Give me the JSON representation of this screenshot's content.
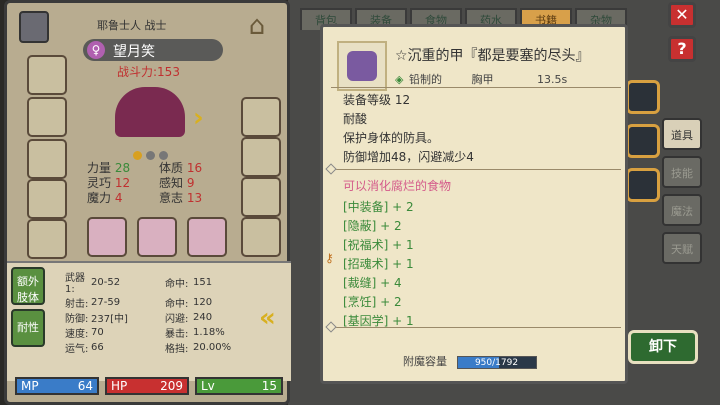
{
  "character": {
    "title": "耶鲁士人 战士",
    "name": "望月笑",
    "power": "战斗力:153",
    "attrs": [
      {
        "k": "力量",
        "v": "28",
        "color": "#3a8a3a"
      },
      {
        "k": "体质",
        "v": "16",
        "color": "#c03030"
      },
      {
        "k": "灵巧",
        "v": "12",
        "color": "#c03030"
      },
      {
        "k": "感知",
        "v": "9",
        "color": "#c03030"
      },
      {
        "k": "魔力",
        "v": "4",
        "color": "#c03030"
      },
      {
        "k": "意志",
        "v": "13",
        "color": "#c03030"
      }
    ]
  },
  "stats_tabs": [
    "额外肢体",
    "耐性"
  ],
  "stats": [
    [
      "武器1:",
      "20-52",
      "命中:",
      "151"
    ],
    [
      "射击:",
      "27-59",
      "命中:",
      "120"
    ],
    [
      "防御:",
      "237[中]",
      "闪避:",
      "240"
    ],
    [
      "速度:",
      "70",
      "暴击:",
      "1.18%"
    ],
    [
      "运气:",
      "66",
      "格挡:",
      "20.00%"
    ]
  ],
  "bars": [
    {
      "label": "MP",
      "value": "64",
      "color": "#3a7cc8"
    },
    {
      "label": "HP",
      "value": "209",
      "color": "#c83030"
    },
    {
      "label": "Lv",
      "value": "15",
      "color": "#4a9a3a"
    }
  ],
  "tabs": [
    {
      "label": "背包",
      "active": false
    },
    {
      "label": "装备",
      "active": false
    },
    {
      "label": "食物",
      "active": false
    },
    {
      "label": "药水",
      "active": false
    },
    {
      "label": "书籍",
      "active": true
    },
    {
      "label": "杂物",
      "active": false
    }
  ],
  "side_tabs": [
    {
      "label": "道具",
      "active": true
    },
    {
      "label": "技能",
      "active": false
    },
    {
      "label": "魔法",
      "active": false
    },
    {
      "label": "天赋",
      "active": false
    }
  ],
  "item": {
    "name": "☆沉重的甲『都是要塞的尽头』",
    "material": "铅制的",
    "slot": "胸甲",
    "weight": "13.5s",
    "level": "装备等级 12",
    "trait": "耐酸",
    "desc": "保护身体的防具。",
    "effect": "防御增加48，闪避减少4",
    "food_note": "可以消化腐烂的食物",
    "skills": [
      "[中装备] + 2",
      "[隐蔽] + 2",
      "[祝福术] + 1",
      "[招魂术] + 1",
      "[裁缝] + 4",
      "[烹饪] + 2",
      "[基因学] + 1"
    ],
    "enchant_label": "附魔容量",
    "enchant_value": "950/1792",
    "enchant_fraction": 0.53
  },
  "unequip_label": "卸下",
  "colors": {
    "accent": "#d8a040",
    "panel": "#efe6c8",
    "green": "#3a8a3a",
    "pink": "#d45a8a"
  }
}
